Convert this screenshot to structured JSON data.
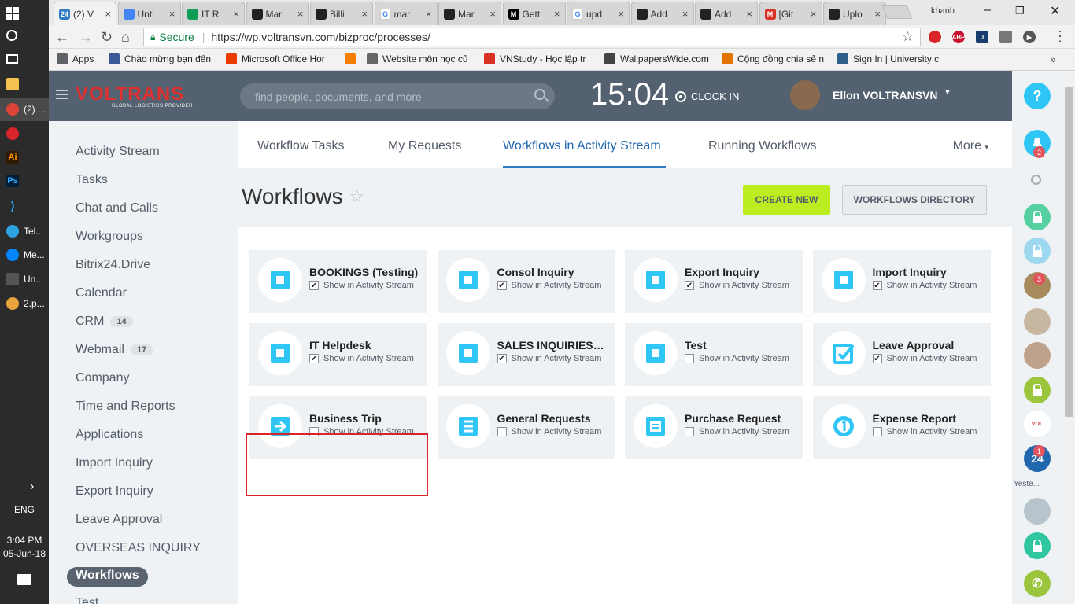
{
  "taskbar": {
    "apps": [
      {
        "label": "(2) ...",
        "icon": "chrome-icon"
      },
      {
        "label": "Tel...",
        "icon": "telegram-icon"
      },
      {
        "label": "Me...",
        "icon": "messenger-icon"
      },
      {
        "label": "Un...",
        "icon": "unity-icon"
      },
      {
        "label": "2.p...",
        "icon": "paint-icon"
      }
    ],
    "lang": "ENG",
    "time": "3:04 PM",
    "date": "05-Jun-18"
  },
  "browser": {
    "tabs": [
      {
        "title": "(2) V",
        "fav_color": "#2f7cc4",
        "fav_text": "24"
      },
      {
        "title": "Unti",
        "fav_color": "#4285f4",
        "fav_text": ""
      },
      {
        "title": "IT R",
        "fav_color": "#0f9d58",
        "fav_text": ""
      },
      {
        "title": "Mar",
        "fav_color": "#222222",
        "fav_text": ""
      },
      {
        "title": "Billi",
        "fav_color": "#222222",
        "fav_text": ""
      },
      {
        "title": "mar",
        "fav_color": "#ffffff",
        "fav_text": "G"
      },
      {
        "title": "Mar",
        "fav_color": "#222222",
        "fav_text": ""
      },
      {
        "title": "Gett",
        "fav_color": "#000000",
        "fav_text": "M"
      },
      {
        "title": "upd",
        "fav_color": "#ffffff",
        "fav_text": "G"
      },
      {
        "title": "Add",
        "fav_color": "#222222",
        "fav_text": ""
      },
      {
        "title": "Add",
        "fav_color": "#222222",
        "fav_text": ""
      },
      {
        "title": "[Git",
        "fav_color": "#d93025",
        "fav_text": "M"
      },
      {
        "title": "Uplo",
        "fav_color": "#222222",
        "fav_text": ""
      }
    ],
    "window_user": "khanh",
    "secure_label": "Secure",
    "url": "https://wp.voltransvn.com/bizproc/processes/",
    "bookmarks": [
      {
        "label": "Apps",
        "color": "#5f6368"
      },
      {
        "label": "Chào mừng bạn đến",
        "color": "#3b5998"
      },
      {
        "label": "Microsoft Office Hor",
        "color": "#eb3c00"
      },
      {
        "label": "",
        "color": "#f57d00"
      },
      {
        "label": "Website môn học củ",
        "color": "#666666"
      },
      {
        "label": "VNStudy - Học lập tr",
        "color": "#d93025"
      },
      {
        "label": "WallpapersWide.com",
        "color": "#444444"
      },
      {
        "label": "Cộng đồng chia sẻ n",
        "color": "#e37400"
      },
      {
        "label": "Sign In | University c",
        "color": "#2f5f8a"
      }
    ]
  },
  "header": {
    "logo_text": "VOLTRANS",
    "logo_sub": "GLOBAL LOGISTICS PROVIDER",
    "search_placeholder": "find people, documents, and more",
    "clock": "15:04",
    "clock_in": "CLOCK IN",
    "username": "Ellon VOLTRANSVN"
  },
  "leftnav": {
    "items": [
      {
        "label": "Activity Stream",
        "badge": ""
      },
      {
        "label": "Tasks",
        "badge": ""
      },
      {
        "label": "Chat and Calls",
        "badge": ""
      },
      {
        "label": "Workgroups",
        "badge": ""
      },
      {
        "label": "Bitrix24.Drive",
        "badge": ""
      },
      {
        "label": "Calendar",
        "badge": ""
      },
      {
        "label": "CRM",
        "badge": "14"
      },
      {
        "label": "Webmail",
        "badge": "17"
      },
      {
        "label": "Company",
        "badge": ""
      },
      {
        "label": "Time and Reports",
        "badge": ""
      },
      {
        "label": "Applications",
        "badge": ""
      },
      {
        "label": "Import Inquiry",
        "badge": ""
      },
      {
        "label": "Export Inquiry",
        "badge": ""
      },
      {
        "label": "Leave Approval",
        "badge": ""
      },
      {
        "label": "OVERSEAS INQUIRY",
        "badge": ""
      }
    ],
    "active": "Workflows",
    "next_partial": "Test"
  },
  "main": {
    "tabs": [
      "Workflow Tasks",
      "My Requests",
      "Workflows in Activity Stream",
      "Running Workflows"
    ],
    "active_tab": "Workflows in Activity Stream",
    "more": "More",
    "title": "Workflows",
    "create_new": "CREATE NEW",
    "workflows_directory": "WORKFLOWS DIRECTORY",
    "show_label": "Show in Activity Stream",
    "cards": [
      {
        "title": "BOOKINGS (Testing)",
        "checked": true,
        "icon": "square"
      },
      {
        "title": "Consol Inquiry",
        "checked": true,
        "icon": "square"
      },
      {
        "title": "Export Inquiry",
        "checked": true,
        "icon": "square"
      },
      {
        "title": "Import Inquiry",
        "checked": true,
        "icon": "square"
      },
      {
        "title": "IT Helpdesk",
        "checked": true,
        "icon": "square"
      },
      {
        "title": "SALES INQUIRIES CUSTOMER",
        "checked": true,
        "icon": "square"
      },
      {
        "title": "Test",
        "checked": false,
        "icon": "square"
      },
      {
        "title": "Leave Approval",
        "checked": true,
        "icon": "check"
      },
      {
        "title": "Business Trip",
        "checked": false,
        "icon": "arrow"
      },
      {
        "title": "General Requests",
        "checked": false,
        "icon": "list"
      },
      {
        "title": "Purchase Request",
        "checked": false,
        "icon": "doc"
      },
      {
        "title": "Expense Report",
        "checked": false,
        "icon": "coin"
      }
    ]
  },
  "rightbar": {
    "notifications_count": "2",
    "contact_badge": "3",
    "b24_badge": "1",
    "yesterday_label": "Yeste..."
  }
}
